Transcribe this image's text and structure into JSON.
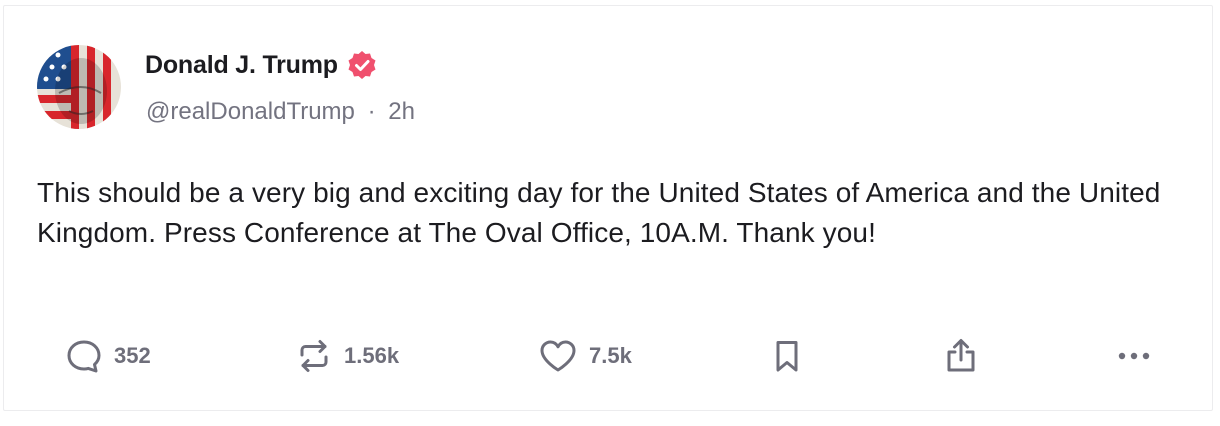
{
  "post": {
    "author_name": "Donald J. Trump",
    "handle": "@realDonaldTrump",
    "separator": "·",
    "time_ago": "2h",
    "text": "This should be a very big and exciting day for the United States of America and the United Kingdom. Press Conference at The Oval Office, 10A.M. Thank you!"
  },
  "actions": {
    "replies": "352",
    "reposts": "1.56k",
    "likes": "7.5k"
  },
  "icons": [
    "reply-icon",
    "repost-icon",
    "like-icon",
    "bookmark-icon",
    "share-icon",
    "more-icon",
    "verified-badge-icon"
  ],
  "colors": {
    "verified_badge": "#f0506e",
    "icon_gray": "#6e6e7a",
    "text_primary": "#1c1c20",
    "text_secondary": "#737380"
  }
}
